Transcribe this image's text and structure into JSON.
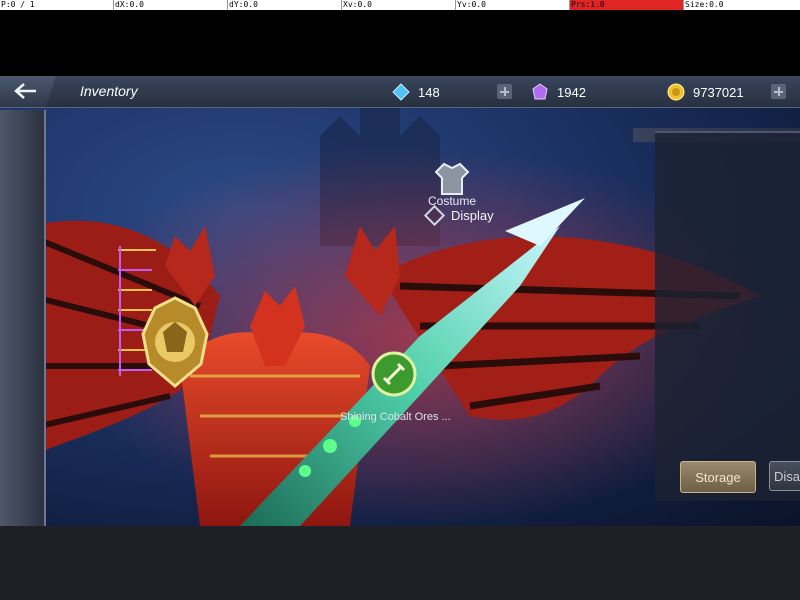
{
  "debug": [
    "P:0 / 1",
    "dX:0.0",
    "dY:0.0",
    "Xv:0.0",
    "Yv:0.0",
    "Prs:1.0",
    "Size:0.0"
  ],
  "header": {
    "title": "Inventory",
    "currencies": [
      {
        "name": "blue-gem-icon",
        "value": "148",
        "color": "#4fc3f7"
      },
      {
        "name": "purple-crystal-icon",
        "value": "1942",
        "color": "#b06cf0"
      },
      {
        "name": "gold-coin-icon",
        "value": "9737021",
        "color": "#f2c12e"
      }
    ]
  },
  "costume": {
    "label": "Costume",
    "display_label": "Display"
  },
  "item_caption": "Shining Cobalt Ores ...",
  "buttons": {
    "storage": "Storage",
    "disassemble": "Disas"
  },
  "colors": {
    "storage_btn": "#8a7a5a",
    "header_bg": "#2f394b",
    "wing_red": "#c2271c",
    "sword_teal": "#3fbf9a"
  }
}
